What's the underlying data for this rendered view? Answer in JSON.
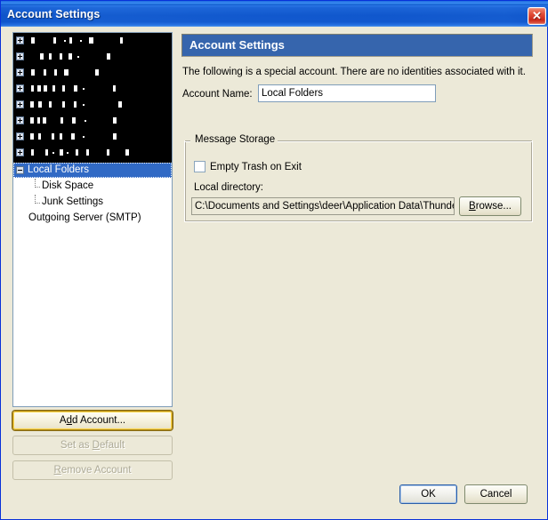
{
  "window": {
    "title": "Account Settings",
    "close_label": "✕"
  },
  "colors": {
    "titlebar_blue": "#0a56c8",
    "selection_blue": "#316ac5",
    "pane_header_blue": "#3665ad",
    "dialog_face": "#ece9d8",
    "close_red": "#d33a24",
    "focus_gold": "#ffd84a"
  },
  "tree": {
    "redacted_rows": 8,
    "items": [
      {
        "label": "Local Folders",
        "selected": true,
        "expander": "minus",
        "level": 0
      },
      {
        "label": "Disk Space",
        "selected": false,
        "expander": "none",
        "level": 1
      },
      {
        "label": "Junk Settings",
        "selected": false,
        "expander": "none",
        "level": 1
      },
      {
        "label": "Outgoing Server (SMTP)",
        "selected": false,
        "expander": "none",
        "level": 0
      }
    ]
  },
  "left_buttons": {
    "add_account": {
      "label_pre": "A",
      "label_acc": "d",
      "label_post": "d Account...",
      "enabled": true
    },
    "set_as_default": {
      "label_pre": "Set as ",
      "label_acc": "D",
      "label_post": "efault",
      "enabled": false
    },
    "remove_account": {
      "label_pre": "",
      "label_acc": "R",
      "label_post": "emove Account",
      "enabled": false
    }
  },
  "pane": {
    "header": "Account Settings",
    "description": "The following is a special account. There are no identities associated with it.",
    "account_name": {
      "label_pre": "Account ",
      "label_acc": "N",
      "label_post": "ame:",
      "value": "Local Folders"
    },
    "group": {
      "title": "Message Storage",
      "empty_trash": {
        "label_pre": "Empty Trash on E",
        "label_acc": "x",
        "label_post": "it",
        "checked": false
      },
      "local_directory": {
        "label_pre": "",
        "label_acc": "L",
        "label_post": "ocal directory:",
        "value": "C:\\Documents and Settings\\deer\\Application Data\\Thunderb"
      },
      "browse": {
        "label_pre": "",
        "label_acc": "B",
        "label_post": "rowse..."
      }
    }
  },
  "dialog_buttons": {
    "ok": "OK",
    "cancel": "Cancel"
  }
}
